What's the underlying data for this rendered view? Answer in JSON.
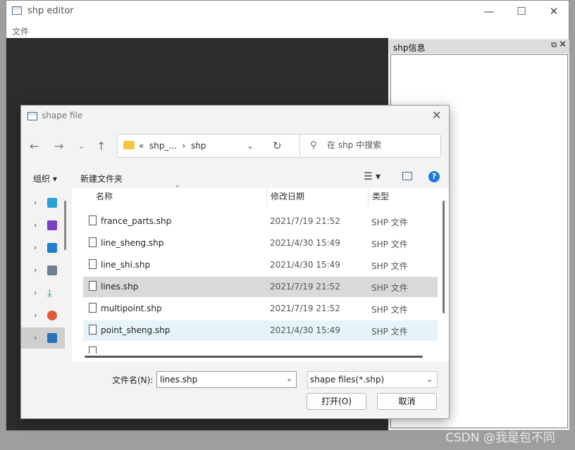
{
  "app": {
    "title": "shp editor",
    "menu_file": "文件"
  },
  "side_panel": {
    "title": "shp信息",
    "float_icon": "restore-icon",
    "close_label": "✕"
  },
  "watermark": "CSDN @我是包不同",
  "dialog": {
    "title": "shape file",
    "address": {
      "text": "«  shp_...  ›  shp"
    },
    "search": {
      "placeholder": "在 shp 中搜索"
    },
    "toolbar": {
      "organize": "组织 ▾",
      "new_folder": "新建文件夹"
    },
    "columns": {
      "name": "名称",
      "date": "修改日期",
      "type": "类型"
    },
    "files": [
      {
        "name": "france_parts.shp",
        "date": "2021/7/19 21:52",
        "type": "SHP 文件"
      },
      {
        "name": "line_sheng.shp",
        "date": "2021/4/30 15:49",
        "type": "SHP 文件"
      },
      {
        "name": "line_shi.shp",
        "date": "2021/4/30 15:49",
        "type": "SHP 文件"
      },
      {
        "name": "lines.shp",
        "date": "2021/7/19 21:52",
        "type": "SHP 文件"
      },
      {
        "name": "multipoint.shp",
        "date": "2021/7/19 21:52",
        "type": "SHP 文件"
      },
      {
        "name": "point_sheng.shp",
        "date": "2021/4/30 15:49",
        "type": "SHP 文件"
      }
    ],
    "file_name_label": "文件名(N):",
    "file_name_value": "lines.shp",
    "file_type": "shape files(*.shp)",
    "open_button": "打开(O)",
    "cancel_button": "取消"
  },
  "colors": {
    "selected_row": "#d9d9d9",
    "hover_row": "#e5f3fb",
    "accent": "#1e7ce0"
  }
}
